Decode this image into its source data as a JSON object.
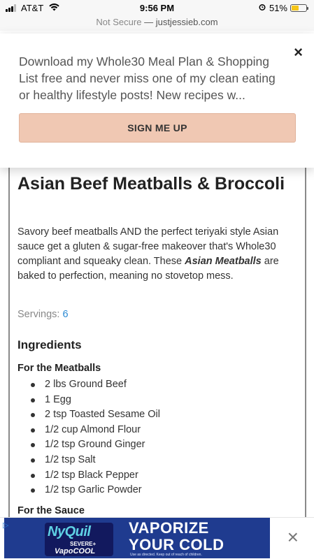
{
  "status_bar": {
    "carrier": "AT&T",
    "time": "9:56 PM",
    "battery_percent": "51%",
    "battery_level": 0.51,
    "signal_bars": 3
  },
  "url_bar": {
    "security": "Not Secure",
    "separator": " — ",
    "domain": "justjessieb.com"
  },
  "popup": {
    "message": "Download my Whole30 Meal Plan & Shopping List free and never miss one of my clean eating or healthy lifestyle posts! New recipes w...",
    "close_label": "×",
    "button_label": "SIGN ME UP"
  },
  "recipe": {
    "title": "Asian Beef Meatballs & Broccoli",
    "description_prefix": "Savory beef meatballs AND the perfect teriyaki style Asian sauce get a gluten & sugar-free makeover that's Whole30 compliant and squeaky clean. These ",
    "description_emphasis": "Asian Meatballs",
    "description_suffix": " are baked to perfection, meaning no stovetop mess.",
    "servings_label": "Servings: ",
    "servings_value": "6",
    "ingredients_heading": "Ingredients",
    "groups": [
      {
        "heading": "For the Meatballs",
        "items": [
          "2 lbs Ground Beef",
          "1 Egg",
          "2 tsp Toasted Sesame Oil",
          "1/2 cup Almond Flour",
          "1/2 tsp Ground Ginger",
          "1/2 tsp Salt",
          "1/2 tsp Black Pepper",
          "1/2 tsp Garlic Powder"
        ]
      },
      {
        "heading": "For the Sauce",
        "items": []
      }
    ]
  },
  "ad": {
    "brand": "NyQuil",
    "brand_sub": "SEVERE+",
    "brand_variant": "VapoCOOL",
    "headline_line1": "VAPORIZE",
    "headline_line2": "YOUR COLD",
    "fine_print": "Use as directed. Keep out of reach of children.",
    "close_label": "×",
    "adchoices_label": "▷"
  }
}
